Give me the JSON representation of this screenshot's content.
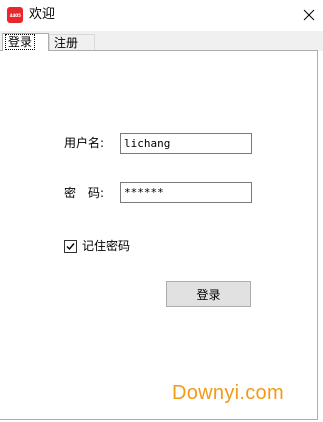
{
  "window": {
    "title": "欢迎",
    "icon_text": "4405",
    "close_icon": "close-icon"
  },
  "tabs": [
    {
      "label": "登录",
      "active": true
    },
    {
      "label": "注册",
      "active": false
    }
  ],
  "form": {
    "username_label": "用户名:",
    "username_value": "lichang",
    "password_label": "密　码:",
    "password_value": "******",
    "remember_label": "记住密码",
    "remember_checked": true,
    "login_button": "登录"
  },
  "watermark": "Downyi.com",
  "colors": {
    "app_icon": "#e8262b",
    "watermark": "#f39a18",
    "button_bg": "#e1e1e1"
  }
}
